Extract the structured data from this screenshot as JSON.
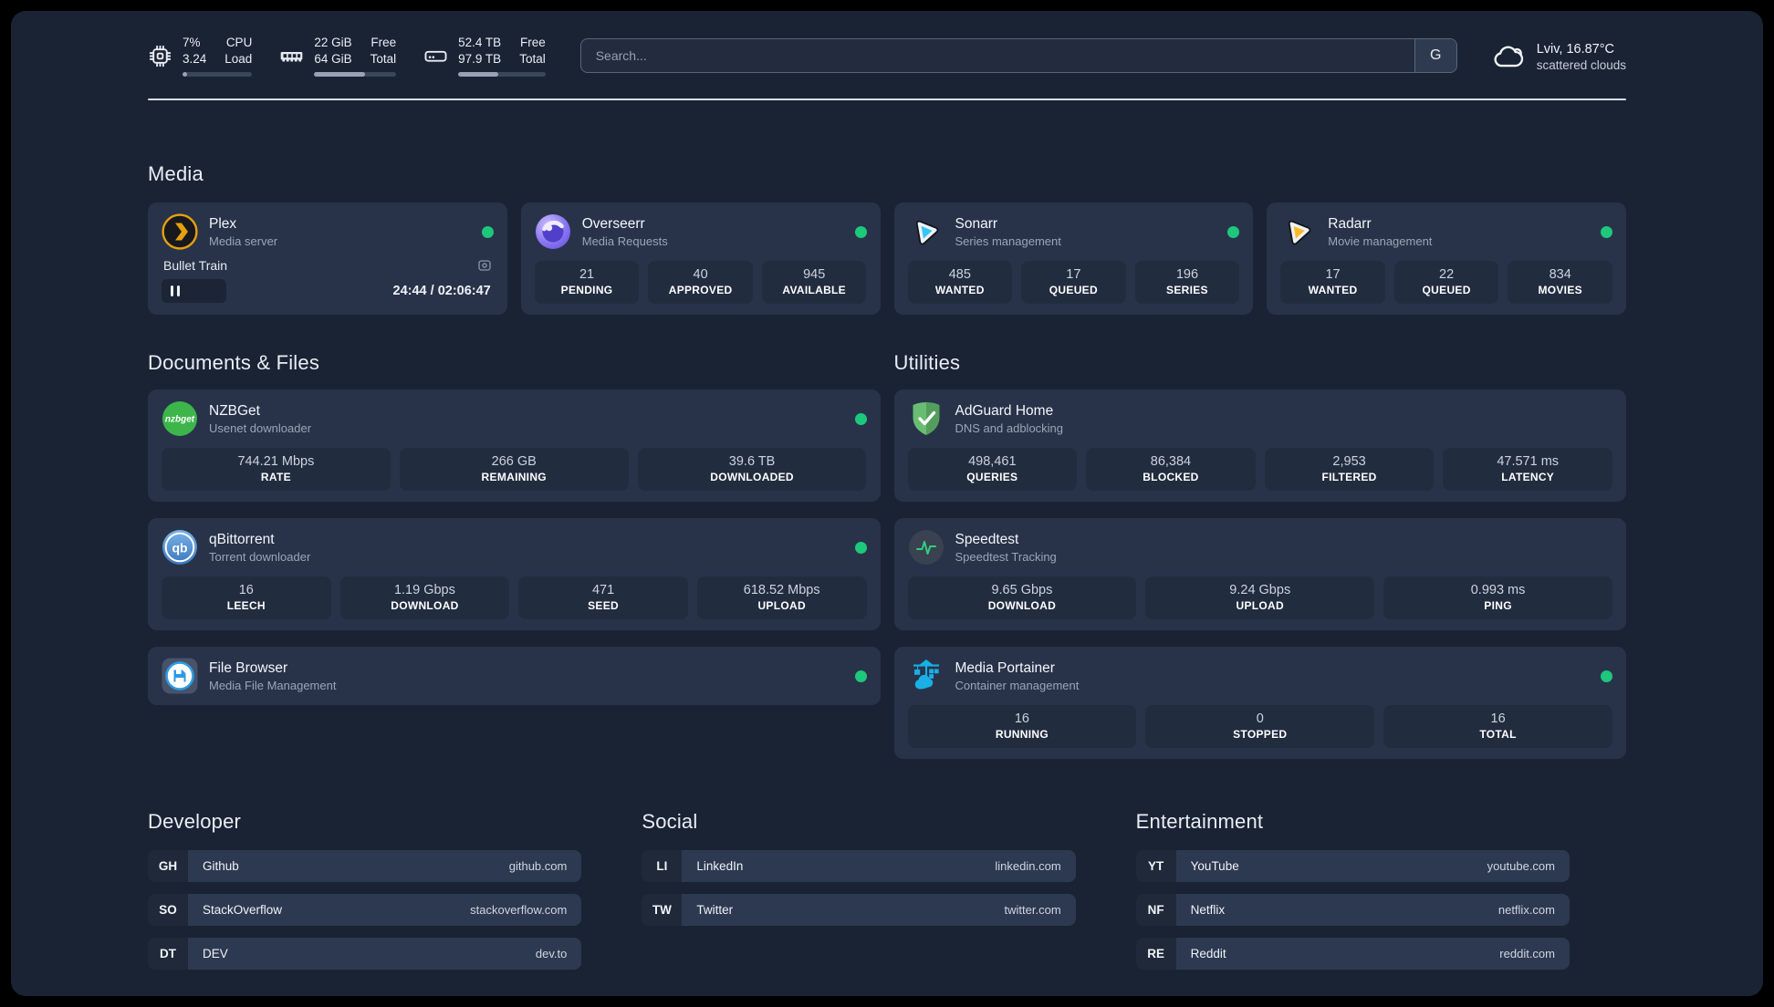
{
  "colors": {
    "status_online": "#1dc77c",
    "plex_orange": "#e5a00d",
    "sonarr_cyan": "#35c5f4",
    "radarr_yellow": "#ffb927",
    "nzbget_green": "#3db54a",
    "qbittorrent_blue": "#4a8fd4",
    "adguard_green": "#69bd72",
    "speedtest_green": "#2fd07e",
    "portainer_blue": "#18b0e6"
  },
  "header": {
    "system_stats": [
      {
        "icon": "cpu-icon",
        "values": [
          "7%",
          "3.24"
        ],
        "labels": [
          "CPU",
          "Load"
        ],
        "progress_pct": 7
      },
      {
        "icon": "ram-icon",
        "values": [
          "22 GiB",
          "64 GiB"
        ],
        "labels": [
          "Free",
          "Total"
        ],
        "progress_pct": 62
      },
      {
        "icon": "disk-icon",
        "values": [
          "52.4 TB",
          "97.9 TB"
        ],
        "labels": [
          "Free",
          "Total"
        ],
        "progress_pct": 46
      }
    ],
    "search": {
      "placeholder": "Search...",
      "button_label": "G"
    },
    "weather": {
      "location_temp": "Lviv, 16.87°C",
      "condition": "scattered clouds"
    }
  },
  "media": {
    "title": "Media",
    "plex": {
      "name": "Plex",
      "subtitle": "Media server",
      "now_playing": "Bullet Train",
      "time": "24:44 / 02:06:47",
      "progress_pct": 19.5
    },
    "overseerr": {
      "name": "Overseerr",
      "subtitle": "Media Requests",
      "stats": [
        {
          "value": "21",
          "label": "PENDING"
        },
        {
          "value": "40",
          "label": "APPROVED"
        },
        {
          "value": "945",
          "label": "AVAILABLE"
        }
      ]
    },
    "sonarr": {
      "name": "Sonarr",
      "subtitle": "Series management",
      "stats": [
        {
          "value": "485",
          "label": "WANTED"
        },
        {
          "value": "17",
          "label": "QUEUED"
        },
        {
          "value": "196",
          "label": "SERIES"
        }
      ]
    },
    "radarr": {
      "name": "Radarr",
      "subtitle": "Movie management",
      "stats": [
        {
          "value": "17",
          "label": "WANTED"
        },
        {
          "value": "22",
          "label": "QUEUED"
        },
        {
          "value": "834",
          "label": "MOVIES"
        }
      ]
    }
  },
  "documents": {
    "title": "Documents & Files",
    "nzbget": {
      "name": "NZBGet",
      "subtitle": "Usenet downloader",
      "icon_label": "nzbget",
      "stats": [
        {
          "value": "744.21 Mbps",
          "label": "RATE"
        },
        {
          "value": "266 GB",
          "label": "REMAINING"
        },
        {
          "value": "39.6 TB",
          "label": "DOWNLOADED"
        }
      ]
    },
    "qbittorrent": {
      "name": "qBittorrent",
      "subtitle": "Torrent downloader",
      "icon_label": "qb",
      "stats": [
        {
          "value": "16",
          "label": "LEECH"
        },
        {
          "value": "1.19 Gbps",
          "label": "DOWNLOAD"
        },
        {
          "value": "471",
          "label": "SEED"
        },
        {
          "value": "618.52 Mbps",
          "label": "UPLOAD"
        }
      ]
    },
    "filebrowser": {
      "name": "File Browser",
      "subtitle": "Media File Management"
    }
  },
  "utilities": {
    "title": "Utilities",
    "adguard": {
      "name": "AdGuard Home",
      "subtitle": "DNS and adblocking",
      "stats": [
        {
          "value": "498,461",
          "label": "QUERIES"
        },
        {
          "value": "86,384",
          "label": "BLOCKED"
        },
        {
          "value": "2,953",
          "label": "FILTERED"
        },
        {
          "value": "47.571 ms",
          "label": "LATENCY"
        }
      ]
    },
    "speedtest": {
      "name": "Speedtest",
      "subtitle": "Speedtest Tracking",
      "stats": [
        {
          "value": "9.65 Gbps",
          "label": "DOWNLOAD"
        },
        {
          "value": "9.24 Gbps",
          "label": "UPLOAD"
        },
        {
          "value": "0.993 ms",
          "label": "PING"
        }
      ]
    },
    "portainer": {
      "name": "Media Portainer",
      "subtitle": "Container management",
      "stats": [
        {
          "value": "16",
          "label": "RUNNING"
        },
        {
          "value": "0",
          "label": "STOPPED"
        },
        {
          "value": "16",
          "label": "TOTAL"
        }
      ]
    }
  },
  "links": {
    "developer": {
      "title": "Developer",
      "items": [
        {
          "abbr": "GH",
          "name": "Github",
          "url": "github.com"
        },
        {
          "abbr": "SO",
          "name": "StackOverflow",
          "url": "stackoverflow.com"
        },
        {
          "abbr": "DT",
          "name": "DEV",
          "url": "dev.to"
        }
      ]
    },
    "social": {
      "title": "Social",
      "items": [
        {
          "abbr": "LI",
          "name": "LinkedIn",
          "url": "linkedin.com"
        },
        {
          "abbr": "TW",
          "name": "Twitter",
          "url": "twitter.com"
        }
      ]
    },
    "entertainment": {
      "title": "Entertainment",
      "items": [
        {
          "abbr": "YT",
          "name": "YouTube",
          "url": "youtube.com"
        },
        {
          "abbr": "NF",
          "name": "Netflix",
          "url": "netflix.com"
        },
        {
          "abbr": "RE",
          "name": "Reddit",
          "url": "reddit.com"
        }
      ]
    }
  }
}
